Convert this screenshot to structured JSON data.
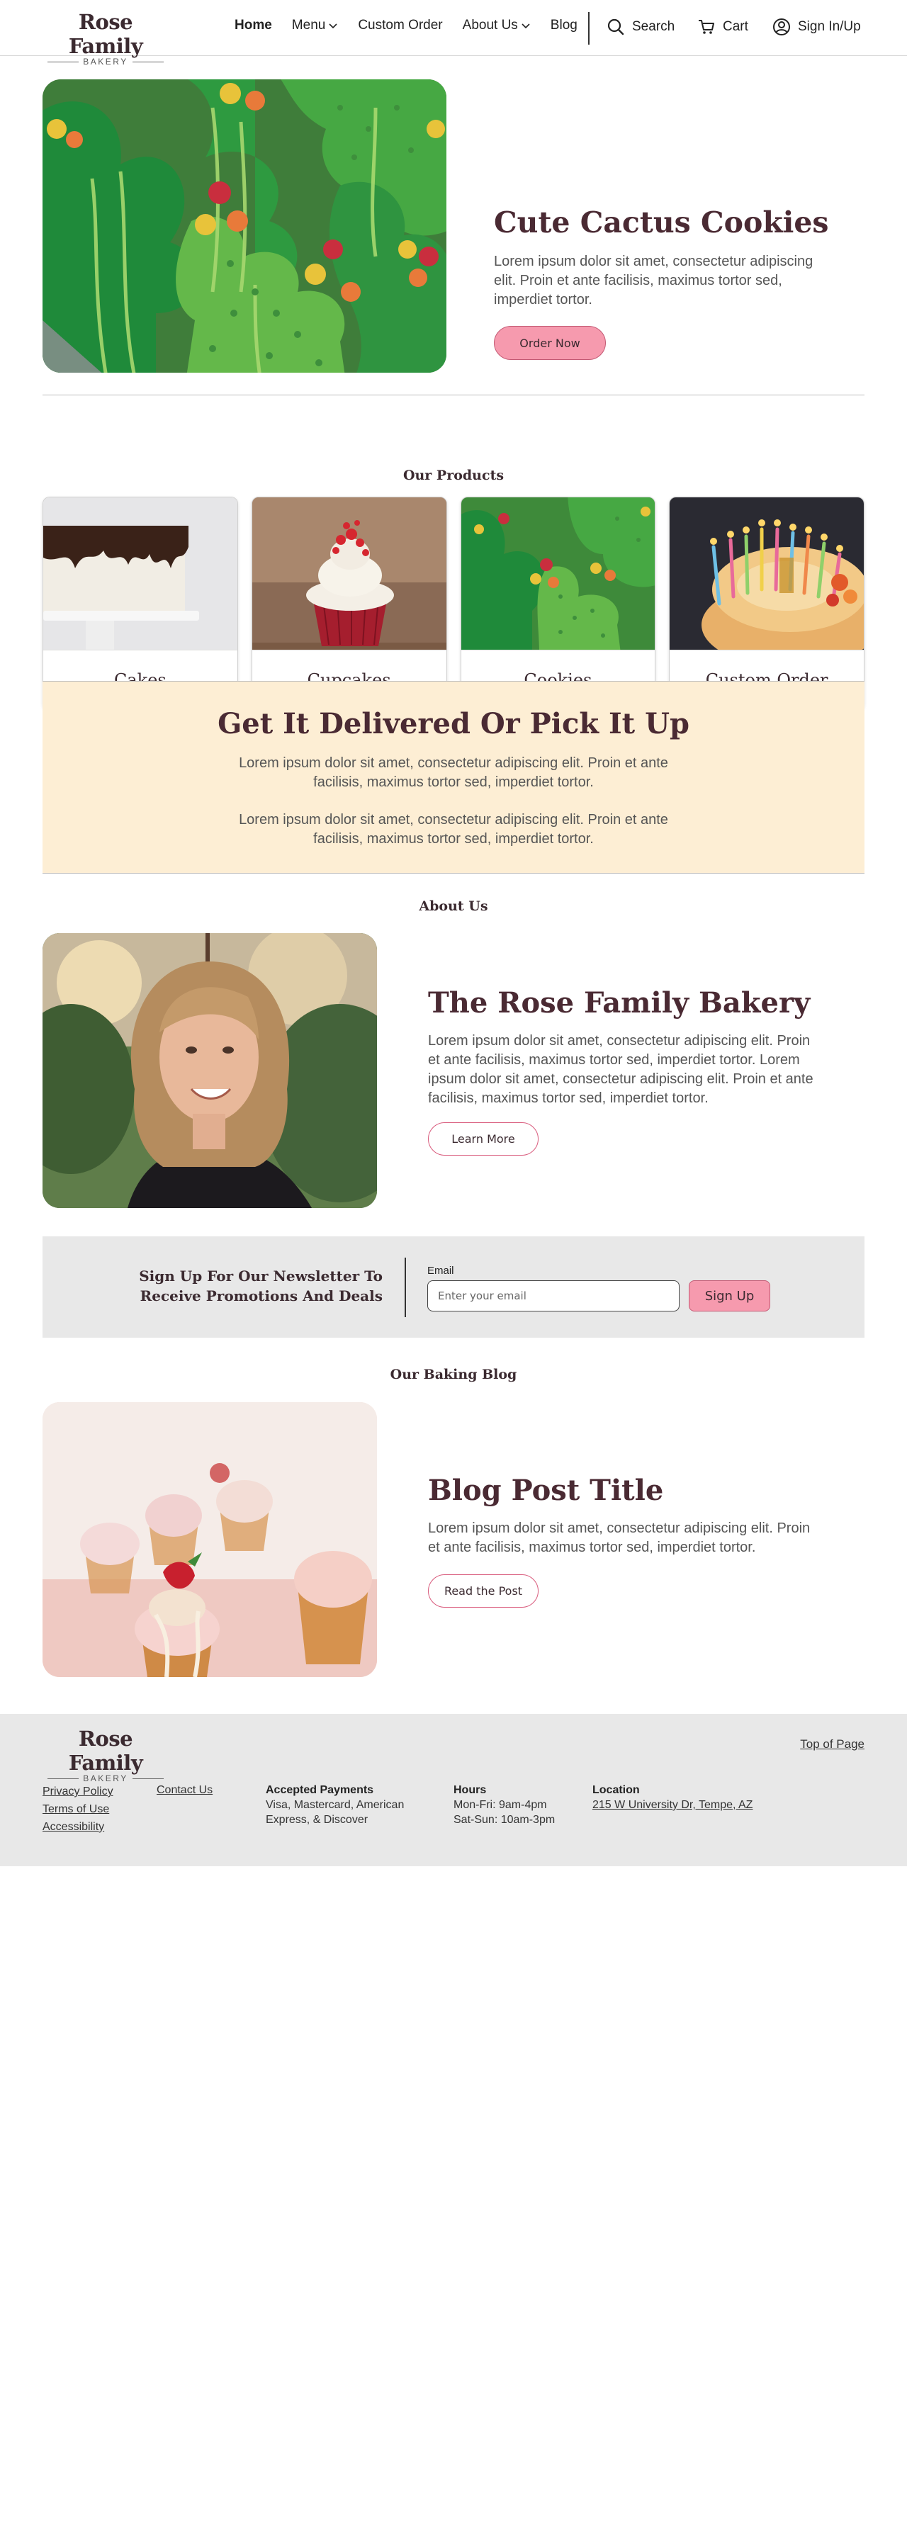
{
  "brand": {
    "name": "Rose Family",
    "sub": "BAKERY"
  },
  "nav": {
    "home": "Home",
    "menu": "Menu",
    "custom_order": "Custom Order",
    "about": "About Us",
    "blog": "Blog",
    "search": "Search",
    "cart": "Cart",
    "sign_in": "Sign In/Up"
  },
  "hero": {
    "title": "Cute Cactus Cookies",
    "text": "Lorem ipsum dolor sit amet, consectetur adipiscing elit. Proin et ante facilisis, maximus tortor sed, imperdiet tortor.",
    "button": "Order Now"
  },
  "products": {
    "label": "Our Products",
    "items": [
      {
        "label": "Cakes"
      },
      {
        "label": "Cupcakes"
      },
      {
        "label": "Cookies"
      },
      {
        "label": "Custom Order"
      }
    ]
  },
  "delivery": {
    "title": "Get It Delivered Or Pick It Up",
    "p1": "Lorem ipsum dolor sit amet, consectetur adipiscing elit. Proin et ante facilisis, maximus tortor sed, imperdiet tortor.",
    "p2": "Lorem ipsum dolor sit amet, consectetur adipiscing elit. Proin et ante facilisis, maximus tortor sed, imperdiet tortor."
  },
  "about": {
    "label": "About Us",
    "title": "The Rose Family Bakery",
    "text": "Lorem ipsum dolor sit amet, consectetur adipiscing elit. Proin et ante facilisis, maximus tortor sed, imperdiet tortor. Lorem ipsum dolor sit amet, consectetur adipiscing elit. Proin et ante facilisis, maximus tortor sed, imperdiet tortor.",
    "button": "Learn More"
  },
  "newsletter": {
    "line1": "Sign Up For Our Newsletter To",
    "line2": "Receive Promotions And Deals",
    "email_label": "Email",
    "placeholder": "Enter your email",
    "button": "Sign Up"
  },
  "blog": {
    "label": "Our Baking Blog",
    "title": "Blog Post Title",
    "text": "Lorem ipsum dolor sit amet, consectetur adipiscing elit. Proin et ante facilisis, maximus tortor sed, imperdiet tortor.",
    "button": "Read the Post"
  },
  "footer": {
    "top_link": "Top of Page",
    "privacy": "Privacy Policy",
    "terms": "Terms of Use",
    "accessibility": "Accessibility",
    "contact": "Contact Us",
    "payments_title": "Accepted Payments",
    "payments_line1": "Visa, Mastercard, American",
    "payments_line2": "Express, & Discover",
    "hours_title": "Hours",
    "hours_line1": "Mon-Fri: 9am-4pm",
    "hours_line2": "Sat-Sun: 10am-3pm",
    "location_title": "Location",
    "address": "215 W University Dr, Tempe, AZ"
  },
  "colors": {
    "accent_pink": "#f69aae",
    "heading": "#4a2a33",
    "delivery_bg": "#fdeed4",
    "band_gray": "#e8e8e8"
  }
}
